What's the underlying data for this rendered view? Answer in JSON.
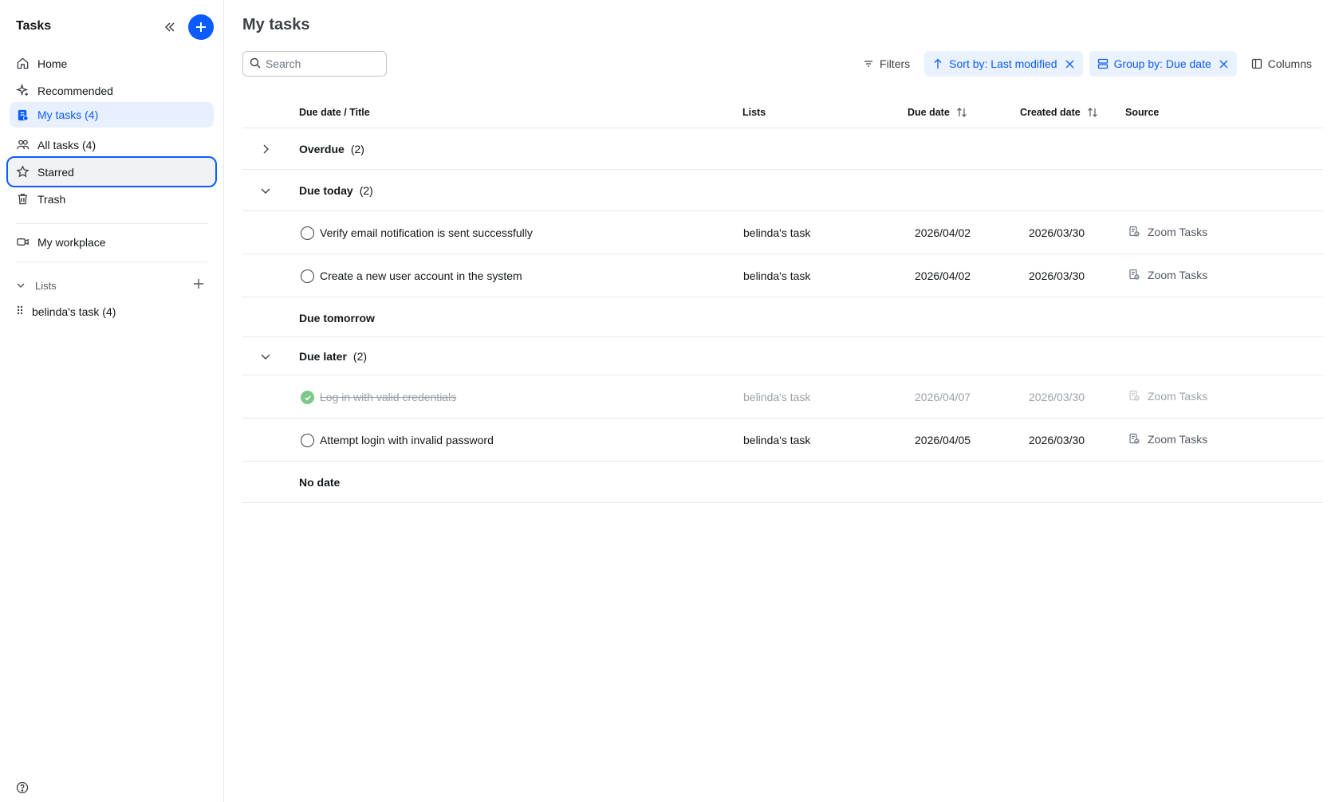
{
  "app": {
    "title": "Tasks"
  },
  "sidebar": {
    "nav": [
      {
        "label": "Home",
        "icon": "home-icon"
      },
      {
        "label": "Recommended",
        "icon": "sparkle-icon"
      },
      {
        "label": "My tasks (4)",
        "icon": "my-tasks-icon"
      },
      {
        "label": "All tasks (4)",
        "icon": "people-icon"
      },
      {
        "label": "Starred",
        "icon": "star-icon"
      },
      {
        "label": "Trash",
        "icon": "trash-icon"
      }
    ],
    "workplace": {
      "label": "My workplace",
      "icon": "video-icon"
    },
    "lists_header": "Lists",
    "lists": [
      {
        "label": "belinda's task (4)"
      }
    ]
  },
  "main": {
    "title": "My tasks",
    "search": {
      "placeholder": "Search",
      "value": ""
    },
    "toolbar": {
      "filters": "Filters",
      "sort": "Sort by: Last modified",
      "group": "Group by: Due date",
      "columns": "Columns"
    },
    "columns": [
      "Due date / Title",
      "Lists",
      "Due date",
      "Created date",
      "Source"
    ],
    "groups": [
      {
        "label": "Overdue",
        "count": "(2)",
        "expanded": false,
        "tasks": []
      },
      {
        "label": "Due today",
        "count": "(2)",
        "expanded": true,
        "tasks": [
          {
            "title": "Verify email notification is sent successfully",
            "list": "belinda's task",
            "due": "2026/04/02",
            "created": "2026/03/30",
            "source": "Zoom Tasks",
            "completed": false
          },
          {
            "title": "Create a new user account in the system",
            "list": "belinda's task",
            "due": "2026/04/02",
            "created": "2026/03/30",
            "source": "Zoom Tasks",
            "completed": false
          }
        ]
      },
      {
        "label": "Due tomorrow",
        "count": "",
        "expanded": null,
        "tasks": []
      },
      {
        "label": "Due later",
        "count": "(2)",
        "expanded": true,
        "tasks": [
          {
            "title": "Log in with valid credentials",
            "list": "belinda's task",
            "due": "2026/04/07",
            "created": "2026/03/30",
            "source": "Zoom Tasks",
            "completed": true
          },
          {
            "title": "Attempt login with invalid password",
            "list": "belinda's task",
            "due": "2026/04/05",
            "created": "2026/03/30",
            "source": "Zoom Tasks",
            "completed": false
          }
        ]
      },
      {
        "label": "No date",
        "count": "",
        "expanded": null,
        "tasks": []
      }
    ]
  },
  "colors": {
    "accent": "#0b5cff",
    "done": "#7ec98a"
  }
}
